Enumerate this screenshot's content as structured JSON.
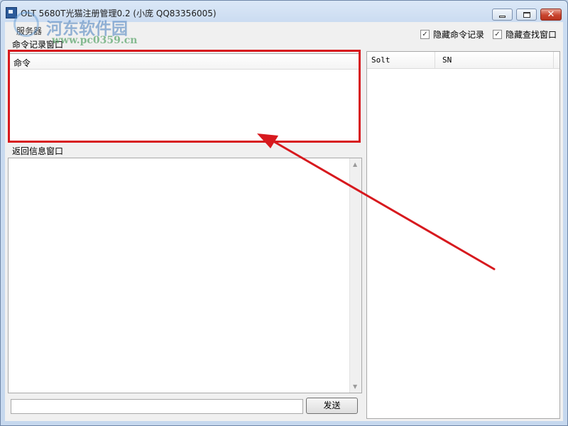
{
  "window": {
    "title": "OLT 5680T光猫注册管理0.2 (小庞 QQ83356005)",
    "min_label": "",
    "max_label": "",
    "close_label": "✕"
  },
  "menu": {
    "item": "服务器"
  },
  "watermark": {
    "name": "河东软件园",
    "url": "www.pc0359.cn"
  },
  "options": {
    "hide_cmd_record": {
      "label": "隐藏命令记录",
      "checked": true
    },
    "hide_search_window": {
      "label": "隐藏查找窗口",
      "checked": true
    }
  },
  "cmd_record": {
    "section_label": "命令记录窗口",
    "column_header": "命令",
    "rows": []
  },
  "response": {
    "section_label": "返回信息窗口",
    "content": ""
  },
  "send": {
    "input_value": "",
    "button_label": "发送"
  },
  "search_list": {
    "columns": [
      "Solt",
      "SN"
    ],
    "rows": []
  },
  "colors": {
    "highlight": "#d7191e",
    "arrow": "#d7191e"
  },
  "icons": {
    "checkbox": "checkmark-icon",
    "scroll_up": "scroll-up-arrow-icon",
    "scroll_down": "scroll-down-arrow-icon"
  }
}
